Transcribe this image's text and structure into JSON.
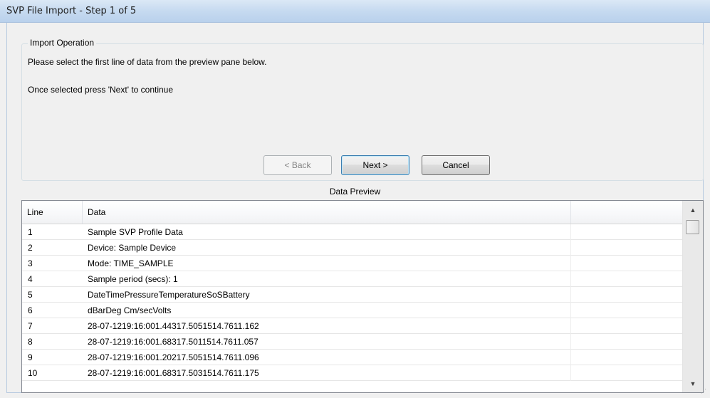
{
  "window": {
    "title": "SVP File Import - Step 1 of 5"
  },
  "import_operation": {
    "legend": "Import Operation",
    "instruction": "Please select the first line of data from the preview pane below.",
    "hint": "Once selected press 'Next' to continue"
  },
  "buttons": {
    "back": "< Back",
    "next": "Next >",
    "cancel": "Cancel"
  },
  "preview": {
    "label": "Data Preview",
    "columns": {
      "line": "Line",
      "data": "Data"
    },
    "rows": [
      {
        "line": "1",
        "data": "Sample SVP Profile Data"
      },
      {
        "line": "2",
        "data": "Device: Sample Device"
      },
      {
        "line": "3",
        "data": "Mode: TIME_SAMPLE"
      },
      {
        "line": "4",
        "data": "Sample period (secs): 1"
      },
      {
        "line": "5",
        "data": "DateTimePressureTemperatureSoSBattery"
      },
      {
        "line": "6",
        "data": "dBarDeg Cm/secVolts"
      },
      {
        "line": "7",
        "data": "28-07-1219:16:001.44317.5051514.7611.162"
      },
      {
        "line": "8",
        "data": "28-07-1219:16:001.68317.5011514.7611.057"
      },
      {
        "line": "9",
        "data": "28-07-1219:16:001.20217.5051514.7611.096"
      },
      {
        "line": "10",
        "data": "28-07-1219:16:001.68317.5031514.7611.175"
      }
    ]
  },
  "scrollbar": {
    "up_icon": "triangle-up",
    "down_icon": "triangle-down"
  }
}
